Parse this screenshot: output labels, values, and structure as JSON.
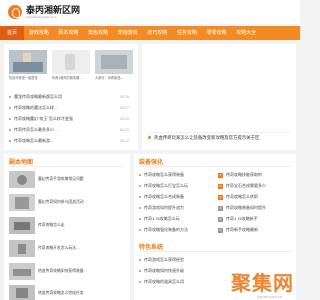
{
  "site": {
    "name": "泰丙湘新区网",
    "subtitle": "www.tbxiangxinqu.com"
  },
  "nav": [
    "首页",
    "游戏攻略",
    "刷本攻略",
    "角色攻略",
    "宠物游戏",
    "技巧攻略",
    "任务攻略",
    "零零攻略",
    "攻略大全"
  ],
  "featured_captions": [
    "热血传奇是一级属性…",
    "传奇1番外的新攻略…",
    "大家好，传奇新品…"
  ],
  "top_list": [
    {
      "title": "魔龙传奇攻略最新版怎么用",
      "date": "05-29"
    },
    {
      "title": "传奇攻略的魔法怎么样…",
      "date": "05-27"
    },
    {
      "title": "传奇攻略魔幻\"攻玉\"怎么样才变强",
      "date": "05-24"
    },
    {
      "title": "传奇传奇怎么最多多少…",
      "date": "05-23"
    },
    {
      "title": "传奇攻略怎么最新游…",
      "date": "05-22"
    }
  ],
  "hot_story": {
    "title": "热血传奇玩家怎么让装备改变新攻略及官方提示关于区"
  },
  "sec_left": {
    "title": "副本地图"
  },
  "left_list": [
    {
      "title": "魔幻传奇手游攻略常见问题",
      "date": "05-28"
    },
    {
      "title": "魔幻传奇如何参与团战活动",
      "date": "05-25"
    },
    {
      "title": "传奇攻略怎么走",
      "date": "05-24"
    },
    {
      "title": "传奇攻略开发怎么玩法…",
      "date": "05-22"
    },
    {
      "title": "热血传奇攻略如何获得装备…",
      "date": "05-20"
    },
    {
      "title": "热血传奇攻略怎么完成任务",
      "date": "05-19"
    }
  ],
  "sec_mid": {
    "title": "装备强化"
  },
  "mid_list": [
    {
      "title": "传奇攻略怎么获得装备",
      "date": "05-29"
    },
    {
      "title": "传奇攻略怎么打宝怎么玩",
      "date": "05-27"
    },
    {
      "title": "传奇攻略怎么合成装备",
      "date": "05-26"
    },
    {
      "title": "传奇游戏如何提升战力",
      "date": "05-25"
    },
    {
      "title": "传奇1.76攻略怎么玩",
      "date": "05-24"
    },
    {
      "title": "传奇攻略强化装备的方法",
      "date": "05-23"
    }
  ],
  "right_list": [
    {
      "title": "传奇攻略技能获取的",
      "date": "05-29"
    },
    {
      "title": "传奇宝石合成需要多少",
      "date": "05-28"
    },
    {
      "title": "传奇攻略怎么转职",
      "date": "05-27"
    },
    {
      "title": "传奇攻略装备如何提升",
      "date": "05-26"
    },
    {
      "title": "传奇1.76攻略新手",
      "date": "05-25"
    },
    {
      "title": "传奇新手攻略最新",
      "date": "05-24"
    }
  ],
  "sec_bottom": {
    "title": "特色系统"
  },
  "bottom_list": [
    {
      "title": "传奇游戏怎么获得经验",
      "date": "05-29"
    },
    {
      "title": "传奇攻略如何快速升级",
      "date": "05-27"
    },
    {
      "title": "传奇攻略的道具怎么用",
      "date": "05-25"
    }
  ],
  "watermark": {
    "text": "聚集网",
    "sub": "juji.ee.com.cn"
  },
  "colors": {
    "accent": "#f07d1d",
    "nav": "#f38b24",
    "nav_active": "#e15e12"
  }
}
